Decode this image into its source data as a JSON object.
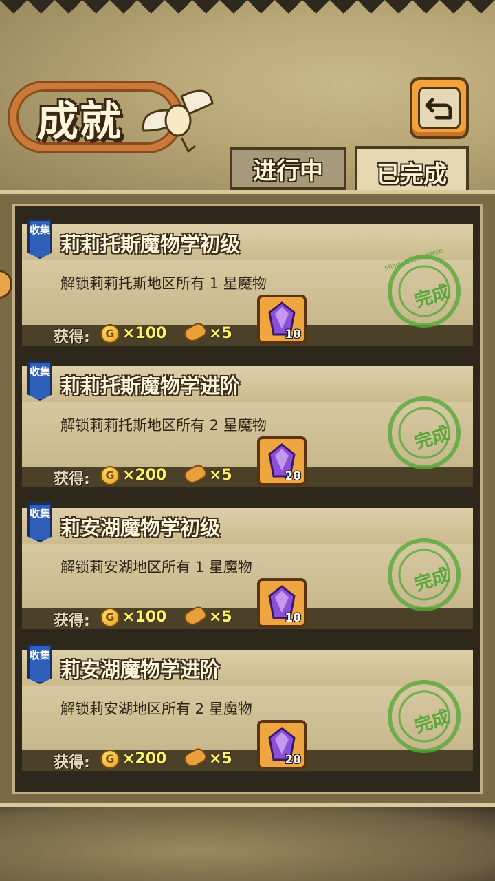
{
  "header": {
    "title": "成就",
    "back_icon": "back-arrow-icon"
  },
  "tabs": [
    {
      "label": "进行中",
      "active": false
    },
    {
      "label": "已完成",
      "active": true
    }
  ],
  "achievements": [
    {
      "badge": "收集",
      "title": "莉莉托斯魔物学初级",
      "description": "解锁莉莉托斯地区所有 1 星魔物",
      "reward_label": "获得:",
      "coins": "×100",
      "bread": "×5",
      "gems": "10",
      "stamp": "完成"
    },
    {
      "badge": "收集",
      "title": "莉莉托斯魔物学进阶",
      "description": "解锁莉莉托斯地区所有 2 星魔物",
      "reward_label": "获得:",
      "coins": "×200",
      "bread": "×5",
      "gems": "20",
      "stamp": "完成"
    },
    {
      "badge": "收集",
      "title": "莉安湖魔物学初级",
      "description": "解锁莉安湖地区所有 1 星魔物",
      "reward_label": "获得:",
      "coins": "×100",
      "bread": "×5",
      "gems": "10",
      "stamp": "完成"
    },
    {
      "badge": "收集",
      "title": "莉安湖魔物学进阶",
      "description": "解锁莉安湖地区所有 2 星魔物",
      "reward_label": "获得:",
      "coins": "×200",
      "bread": "×5",
      "gems": "20",
      "stamp": "完成"
    }
  ],
  "stamp_ring_text": "Mission Complete",
  "colors": {
    "gold_text": "#fff36a",
    "badge_blue": "#2f5fb8",
    "stamp_green": "#56a83a",
    "gem_purple": "#8b4fd8",
    "button_orange": "#f3a33a"
  }
}
